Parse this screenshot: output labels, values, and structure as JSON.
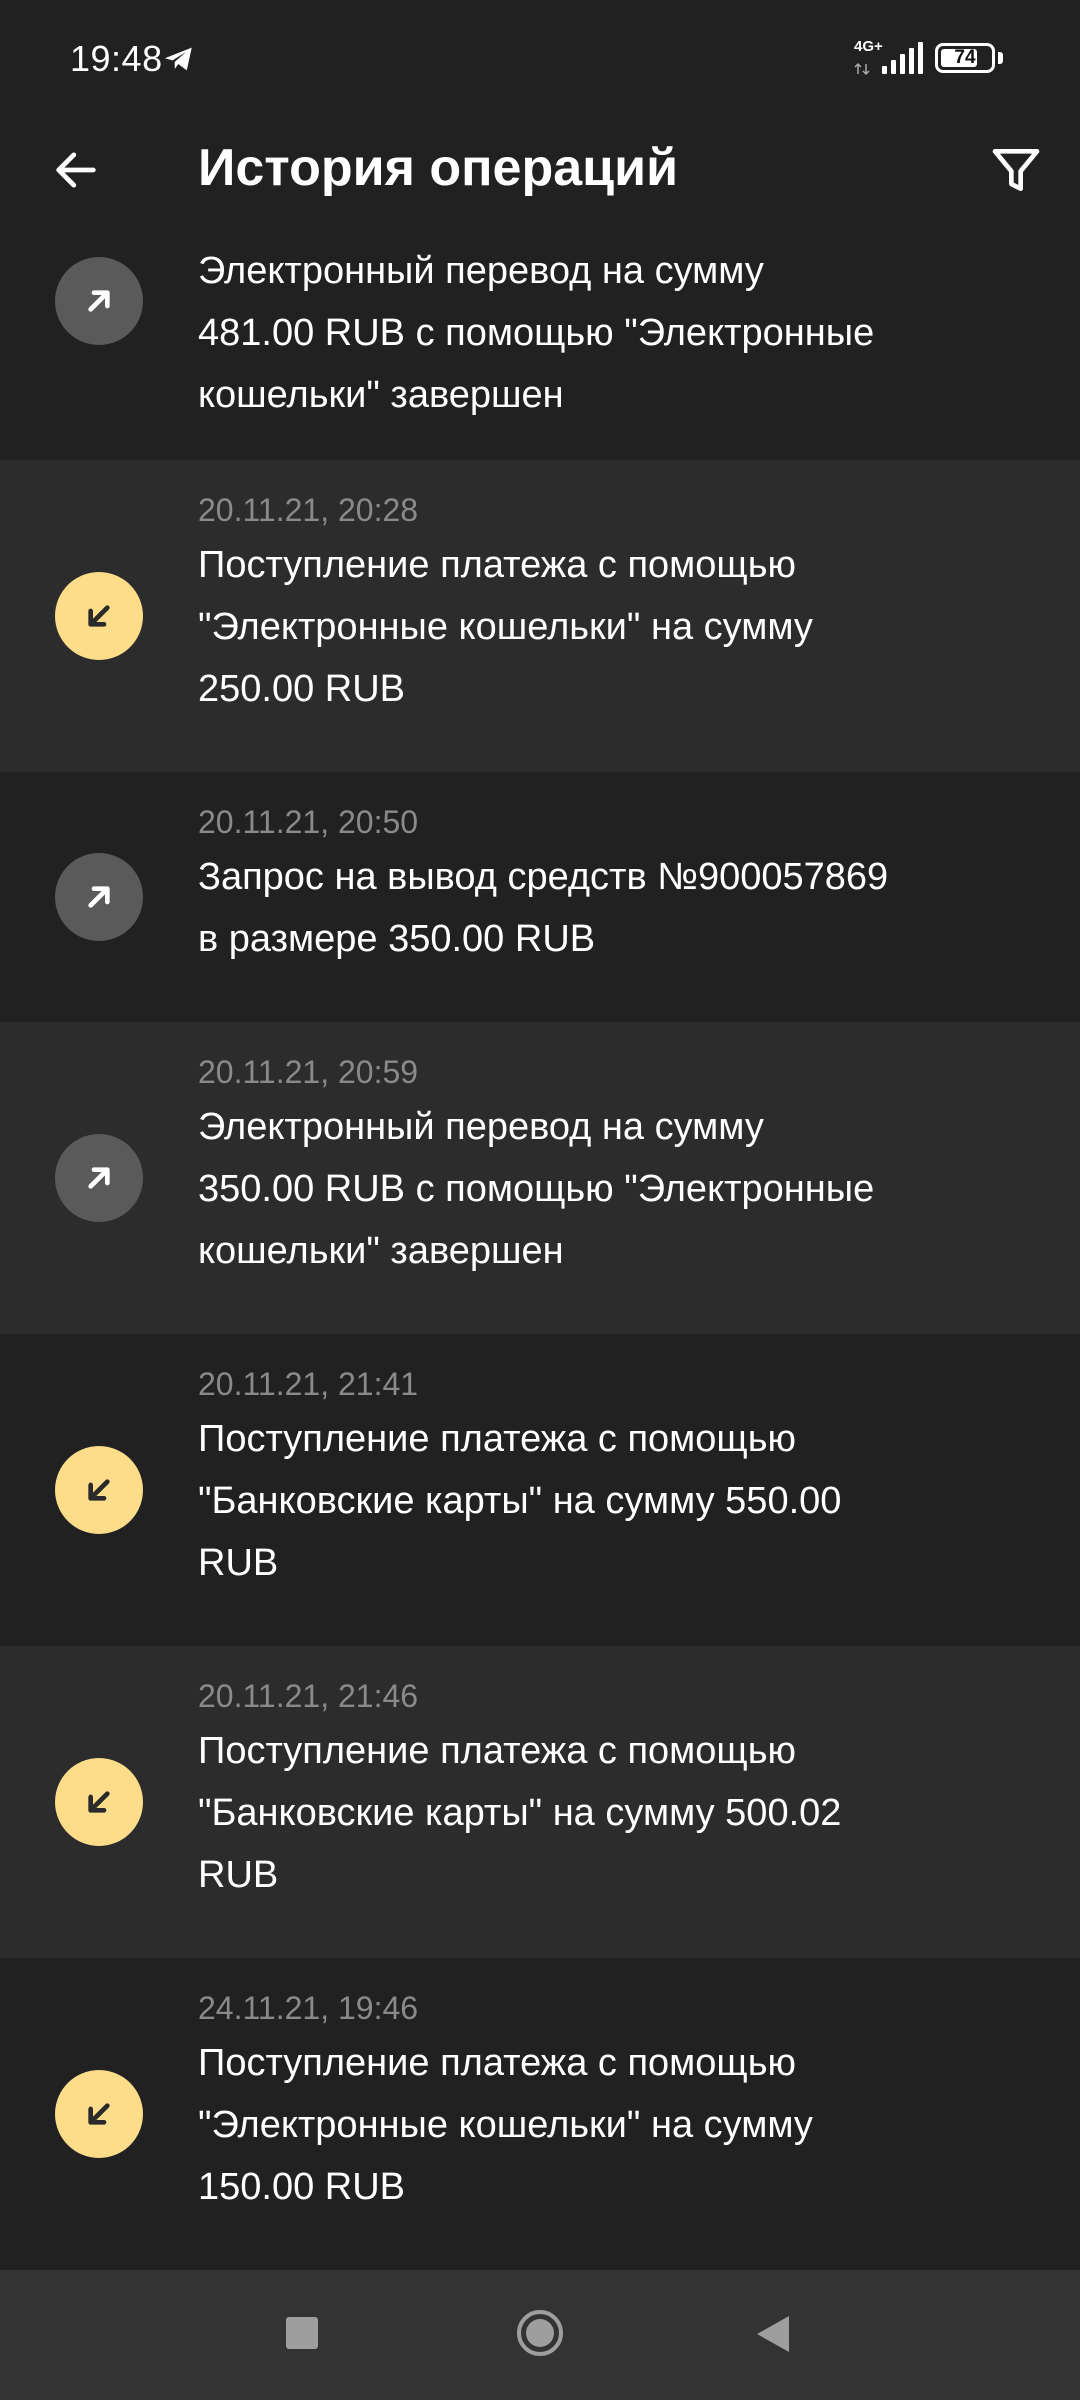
{
  "status_bar": {
    "time": "19:48",
    "network": "4G+",
    "battery": "74",
    "battery_level": 0.74
  },
  "header": {
    "title": "История операций",
    "back_icon": "arrow-left-icon",
    "filter_icon": "filter-icon"
  },
  "operations": [
    {
      "date": "",
      "text": "Электронный перевод на сумму\n481.00 RUB с помощью \"Электронные\nкошельки\" завершен",
      "direction": "outgoing"
    },
    {
      "date": "20.11.21, 20:28",
      "text": "Поступление платежа с помощью\n\"Электронные кошельки\" на сумму\n250.00 RUB",
      "direction": "incoming"
    },
    {
      "date": "20.11.21, 20:50",
      "text": "Запрос на вывод средств №900057869\nв размере 350.00 RUB",
      "direction": "outgoing"
    },
    {
      "date": "20.11.21, 20:59",
      "text": "Электронный перевод на сумму\n350.00 RUB с помощью \"Электронные\nкошельки\" завершен",
      "direction": "outgoing"
    },
    {
      "date": "20.11.21, 21:41",
      "text": "Поступление платежа с помощью\n\"Банковские карты\" на сумму 550.00\nRUB",
      "direction": "incoming"
    },
    {
      "date": "20.11.21, 21:46",
      "text": "Поступление платежа с помощью\n\"Банковские карты\" на сумму 500.02\nRUB",
      "direction": "incoming"
    },
    {
      "date": "24.11.21, 19:46",
      "text": "Поступление платежа с помощью\n\"Электронные кошельки\" на сумму\n150.00 RUB",
      "direction": "incoming"
    }
  ],
  "colors": {
    "background": "#212121",
    "row_alt": "#2c2c2c",
    "incoming_icon_bg": "#fddc8a",
    "outgoing_icon_bg": "#5a5a5a",
    "date_text": "#8a8a8a",
    "nav_bar": "#333333"
  },
  "nav_bar": {
    "recent_icon": "recent-apps-icon",
    "home_icon": "home-icon",
    "back_icon": "back-triangle-icon"
  }
}
